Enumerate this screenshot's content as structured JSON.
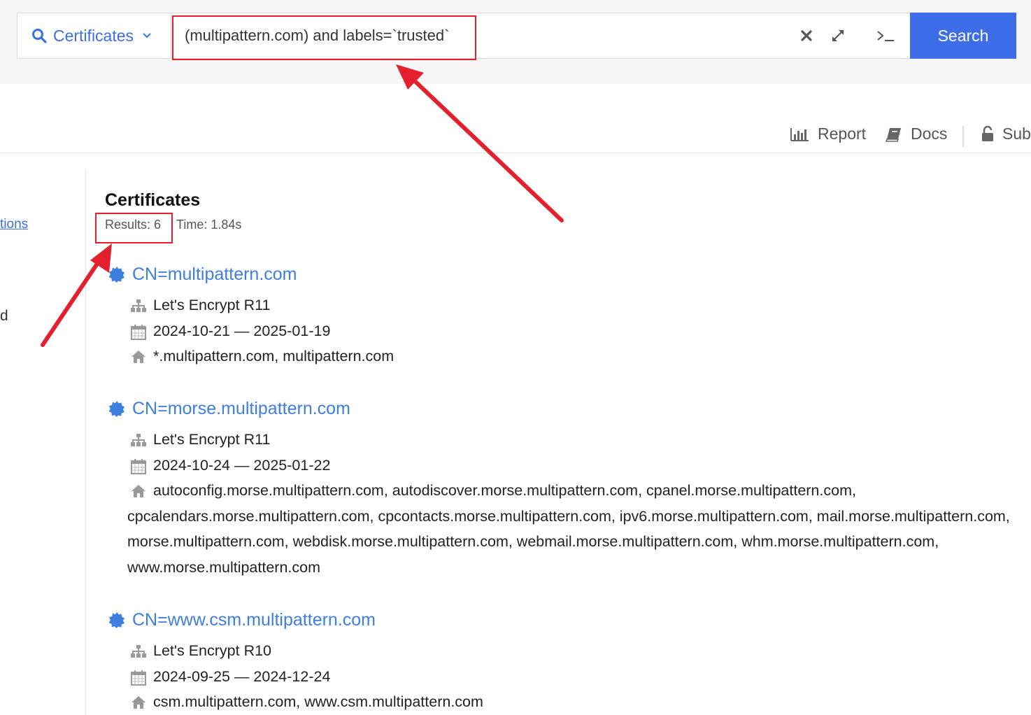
{
  "search": {
    "type_label": "Certificates",
    "query": "(multipattern.com) and labels=`trusted`",
    "search_button": "Search"
  },
  "nav": {
    "report": "Report",
    "docs": "Docs",
    "sub": "Sub"
  },
  "sidebar": {
    "link_fragment": "tions",
    "text_fragment": "d"
  },
  "results": {
    "title": "Certificates",
    "count_label": "Results: 6",
    "time_label": "Time: 1.84s"
  },
  "certificates": [
    {
      "title": "CN=multipattern.com",
      "issuer": "Let's Encrypt R11",
      "validity": "2024-10-21 — 2025-01-19",
      "names": "*.multipattern.com, multipattern.com"
    },
    {
      "title": "CN=morse.multipattern.com",
      "issuer": "Let's Encrypt R11",
      "validity": "2024-10-24 — 2025-01-22",
      "names": "autoconfig.morse.multipattern.com, autodiscover.morse.multipattern.com, cpanel.morse.multipattern.com, cpcalendars.morse.multipattern.com, cpcontacts.morse.multipattern.com, ipv6.morse.multipattern.com, mail.morse.multipattern.com, morse.multipattern.com, webdisk.morse.multipattern.com, webmail.morse.multipattern.com, whm.morse.multipattern.com, www.morse.multipattern.com"
    },
    {
      "title": "CN=www.csm.multipattern.com",
      "issuer": "Let's Encrypt R10",
      "validity": "2024-09-25 — 2024-12-24",
      "names": "csm.multipattern.com, www.csm.multipattern.com"
    }
  ],
  "colors": {
    "accent": "#3d6de8",
    "link": "#3d7fe0",
    "annotation": "#e5202e"
  }
}
